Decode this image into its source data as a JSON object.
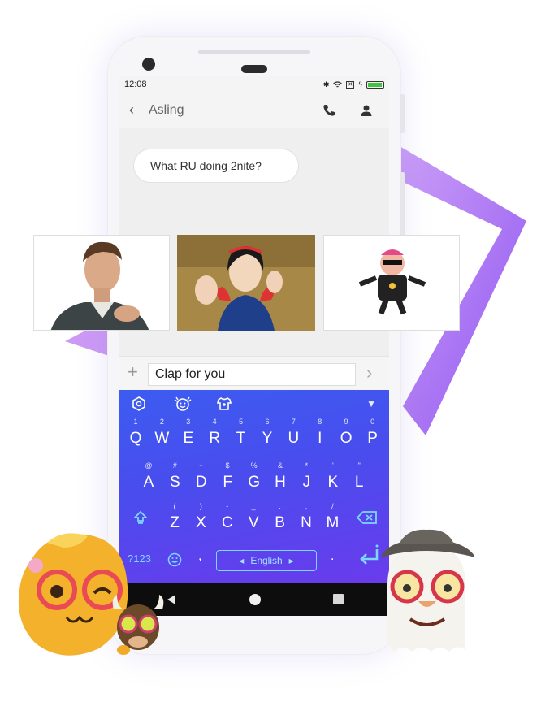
{
  "status_bar": {
    "time": "12:08",
    "icons": [
      "bluetooth-icon",
      "wifi-icon",
      "no-sim-icon",
      "charging-icon",
      "battery-icon"
    ]
  },
  "chat": {
    "contact_name": "Asling",
    "messages": [
      {
        "text": "What RU doing 2nite?",
        "from": "contact"
      }
    ]
  },
  "gif_suggestions": [
    {
      "name": "clapping-man-gif"
    },
    {
      "name": "snow-white-clapping-gif"
    },
    {
      "name": "dancing-cartoon-gif"
    }
  ],
  "input": {
    "value": "Clap for you"
  },
  "keyboard": {
    "toolbar_icons": [
      "theme-icon",
      "emoji-icon",
      "shirt-icon",
      "collapse-icon"
    ],
    "rows": [
      [
        {
          "k": "Q",
          "s": "1"
        },
        {
          "k": "W",
          "s": "2"
        },
        {
          "k": "E",
          "s": "3"
        },
        {
          "k": "R",
          "s": "4"
        },
        {
          "k": "T",
          "s": "5"
        },
        {
          "k": "Y",
          "s": "6"
        },
        {
          "k": "U",
          "s": "7"
        },
        {
          "k": "I",
          "s": "8"
        },
        {
          "k": "O",
          "s": "9"
        },
        {
          "k": "P",
          "s": "0"
        }
      ],
      [
        {
          "k": "A",
          "s": "@"
        },
        {
          "k": "S",
          "s": "#"
        },
        {
          "k": "D",
          "s": "~"
        },
        {
          "k": "F",
          "s": "$"
        },
        {
          "k": "G",
          "s": "%"
        },
        {
          "k": "H",
          "s": "&"
        },
        {
          "k": "J",
          "s": "*"
        },
        {
          "k": "K",
          "s": "'"
        },
        {
          "k": "L",
          "s": "\""
        }
      ],
      [
        {
          "k": "Z",
          "s": "("
        },
        {
          "k": "X",
          "s": ")"
        },
        {
          "k": "C",
          "s": "-"
        },
        {
          "k": "V",
          "s": "_"
        },
        {
          "k": "B",
          "s": ":"
        },
        {
          "k": "N",
          "s": ";"
        },
        {
          "k": "M",
          "s": "/"
        }
      ]
    ],
    "symbols_key": "?123",
    "comma_key": ",",
    "space_label": "English",
    "period_key": ".",
    "accent": "#7ad7ff"
  },
  "colors": {
    "keyboard_start": "#3c5cf0",
    "keyboard_end": "#6a3bec",
    "frame": "#b35cf0"
  }
}
